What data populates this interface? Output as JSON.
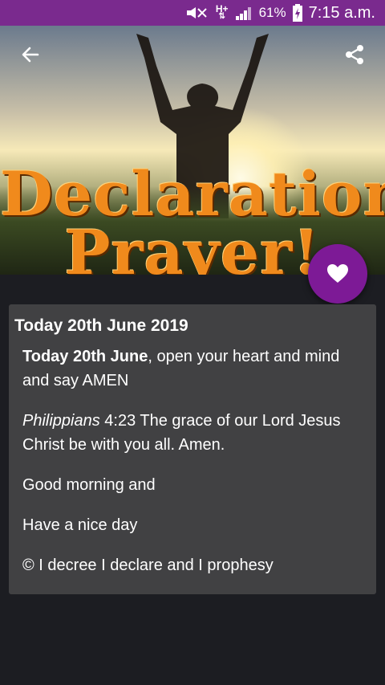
{
  "status": {
    "battery": "61%",
    "time": "7:15 a.m.",
    "network": "H+"
  },
  "hero": {
    "title_line1": "Declaration",
    "title_line2": "Prayer!"
  },
  "card": {
    "title": "Today 20th June 2019",
    "p1_bold": "Today 20th June",
    "p1_rest": ", open your heart and mind and say AMEN",
    "p2_italic": "Philippians",
    "p2_rest": " 4:23 The grace of our Lord Jesus Christ be with you all. Amen.",
    "p3": "Good morning and",
    "p4": "Have a nice day",
    "p5": "© I decree I declare and I prophesy"
  },
  "colors": {
    "status_bar": "#7a2a8e",
    "fab": "#7d1a96",
    "card": "#414143",
    "background": "#1c1d22"
  }
}
